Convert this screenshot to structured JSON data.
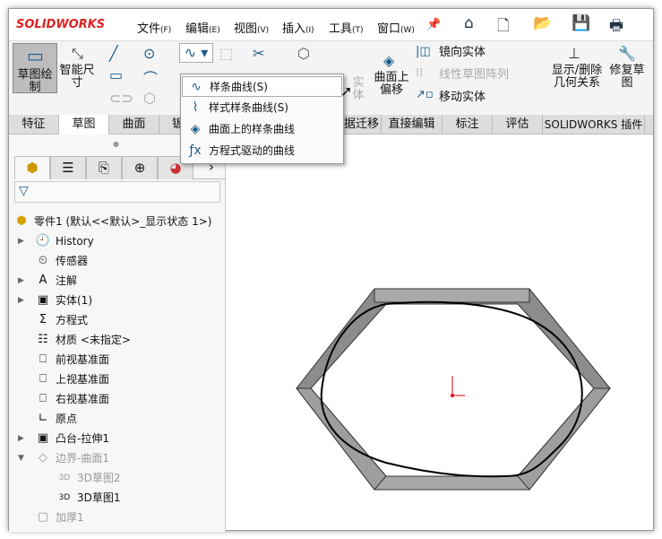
{
  "app": {
    "logo": "SOLIDWORKS"
  },
  "menu": [
    {
      "label": "文件",
      "key": "(F)"
    },
    {
      "label": "编辑",
      "key": "(E)"
    },
    {
      "label": "视图",
      "key": "(V)"
    },
    {
      "label": "插入",
      "key": "(I)"
    },
    {
      "label": "工具",
      "key": "(T)"
    },
    {
      "label": "窗口",
      "key": "(W)"
    }
  ],
  "ribbon": {
    "sketch": "草图绘制",
    "smart_dim": "智能尺寸",
    "convert": "实体",
    "offset_surface": "曲面上偏移",
    "mirror": "镜向实体",
    "linear_pattern": "线性草图阵列",
    "move": "移动实体",
    "show_delete": "显示/删除几何关系",
    "repair": "修复草图"
  },
  "tabs": [
    "特征",
    "草图",
    "曲面",
    "钣",
    "据迁移",
    "直接编辑",
    "标注",
    "评估",
    "SOLIDWORKS 插件"
  ],
  "dropdown": [
    {
      "label": "样条曲线(S)",
      "icon": "spline-icon"
    },
    {
      "label": "样式样条曲线(S)",
      "icon": "style-spline-icon"
    },
    {
      "label": "曲面上的样条曲线",
      "icon": "spline-on-surface-icon"
    },
    {
      "label": "方程式驱动的曲线",
      "icon": "equation-curve-icon"
    }
  ],
  "tree": {
    "root": "零件1  (默认<<默认>_显示状态 1>)",
    "items": [
      {
        "label": "History",
        "expand": "right"
      },
      {
        "label": "传感器"
      },
      {
        "label": "注解",
        "expand": "right"
      },
      {
        "label": "实体(1)",
        "expand": "right"
      },
      {
        "label": "方程式"
      },
      {
        "label": "材质 <未指定>"
      },
      {
        "label": "前视基准面"
      },
      {
        "label": "上视基准面"
      },
      {
        "label": "右视基准面"
      },
      {
        "label": "原点"
      },
      {
        "label": "凸台-拉伸1",
        "expand": "right"
      },
      {
        "label": "边界-曲面1",
        "expand": "down",
        "dim": true
      },
      {
        "label": "3D草图2",
        "dim": true,
        "indent": true
      },
      {
        "label": "3D草图1",
        "indent": true
      },
      {
        "label": "加厚1",
        "dim": true
      }
    ]
  },
  "colors": {
    "brand": "#d22222",
    "accent": "#1a5a8a"
  }
}
